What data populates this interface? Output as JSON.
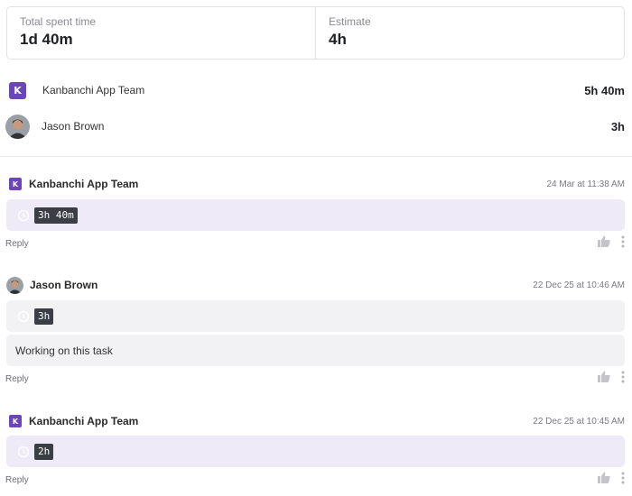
{
  "summary": {
    "spent_label": "Total spent time",
    "spent_value": "1d 40m",
    "estimate_label": "Estimate",
    "estimate_value": "4h"
  },
  "participants": [
    {
      "logo_letter": "K",
      "name": "Kanbanchi App Team",
      "time": "5h 40m"
    },
    {
      "name": "Jason Brown",
      "time": "3h"
    }
  ],
  "comments": [
    {
      "author": "Kanbanchi App Team",
      "date": "24 Mar at 11:38 AM",
      "time_chip": "3h 40m",
      "reply_label": "Reply"
    },
    {
      "author": "Jason Brown",
      "date": "22 Dec 25 at 10:46 AM",
      "time_chip": "3h",
      "text": "Working on this task",
      "reply_label": "Reply"
    },
    {
      "author": "Kanbanchi App Team",
      "date": "22 Dec 25 at 10:45 AM",
      "time_chip": "2h",
      "reply_label": "Reply"
    }
  ],
  "colors": {
    "brand": "#6b46b8",
    "team_bubble": "#eeeaf8",
    "user_bubble": "#f2f2f4",
    "chip": "#3b3f45"
  },
  "icons": {
    "clock": "clock-icon",
    "like": "thumbs-up-icon",
    "more": "more-vertical-icon"
  }
}
